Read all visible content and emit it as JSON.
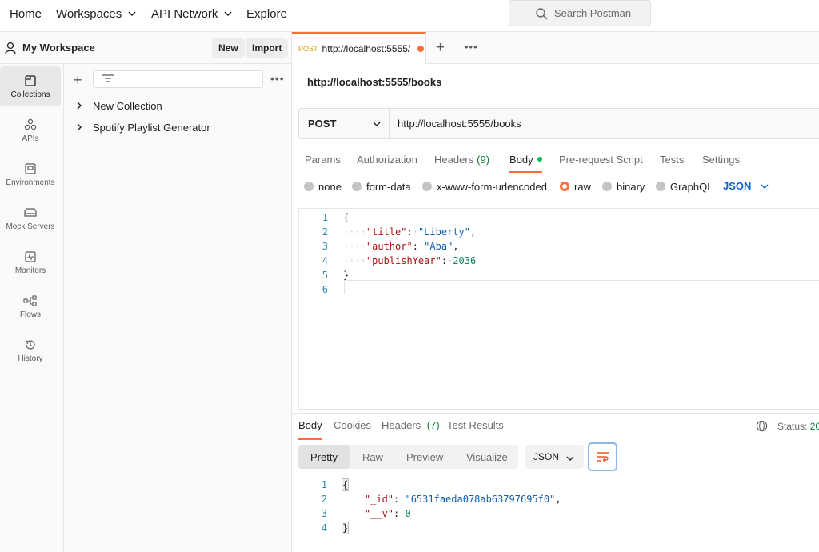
{
  "topnav": {
    "home": "Home",
    "workspaces": "Workspaces",
    "api_network": "API Network",
    "explore": "Explore",
    "search_placeholder": "Search Postman"
  },
  "workspace": {
    "title": "My Workspace",
    "new_label": "New",
    "import_label": "Import"
  },
  "rail": [
    {
      "label": "Collections",
      "icon": "collections-icon",
      "active": true
    },
    {
      "label": "APIs",
      "icon": "apis-icon"
    },
    {
      "label": "Environments",
      "icon": "environments-icon"
    },
    {
      "label": "Mock Servers",
      "icon": "mock-servers-icon"
    },
    {
      "label": "Monitors",
      "icon": "monitors-icon"
    },
    {
      "label": "Flows",
      "icon": "flows-icon"
    },
    {
      "label": "History",
      "icon": "history-icon"
    }
  ],
  "collections": {
    "add": "+",
    "more": "•••",
    "items": [
      "New Collection",
      "Spotify Playlist Generator"
    ]
  },
  "tab": {
    "method": "POST",
    "url": "http://localhost:5555/",
    "add": "+",
    "more": "•••"
  },
  "request": {
    "name": "http://localhost:5555/books",
    "method": "POST",
    "url": "http://localhost:5555/books",
    "tabs": {
      "params": "Params",
      "authorization": "Authorization",
      "headers": "Headers",
      "headers_count": "(9)",
      "body": "Body",
      "prerequest": "Pre-request Script",
      "tests": "Tests",
      "settings": "Settings"
    },
    "body_modes": {
      "none": "none",
      "form_data": "form-data",
      "urlencoded": "x-www-form-urlencoded",
      "raw": "raw",
      "binary": "binary",
      "graphql": "GraphQL",
      "language": "JSON"
    },
    "line_numbers": [
      "1",
      "2",
      "3",
      "4",
      "5",
      "6"
    ],
    "code": {
      "open": "{",
      "title_key": "\"title\"",
      "title_val": "\"Liberty\"",
      "author_key": "\"author\"",
      "author_val": "\"Aba\"",
      "year_key": "\"publishYear\"",
      "year_val": "2036",
      "close": "}"
    }
  },
  "response": {
    "tabs": {
      "body": "Body",
      "cookies": "Cookies",
      "headers": "Headers",
      "headers_count": "(7)",
      "test_results": "Test Results"
    },
    "status_label": "Status:",
    "status_value": "20",
    "views": {
      "pretty": "Pretty",
      "raw": "Raw",
      "preview": "Preview",
      "visualize": "Visualize"
    },
    "format": "JSON",
    "line_numbers": [
      "1",
      "2",
      "3",
      "4"
    ],
    "code": {
      "open": "{",
      "id_key": "\"_id\"",
      "id_val": "\"6531faeda078ab63797695f0\"",
      "v_key": "\"__v\"",
      "v_val": "0",
      "close": "}"
    }
  },
  "colors": {
    "accent": "#ff6c37",
    "link_blue": "#0d63c9",
    "success_green": "#0a7d37"
  }
}
